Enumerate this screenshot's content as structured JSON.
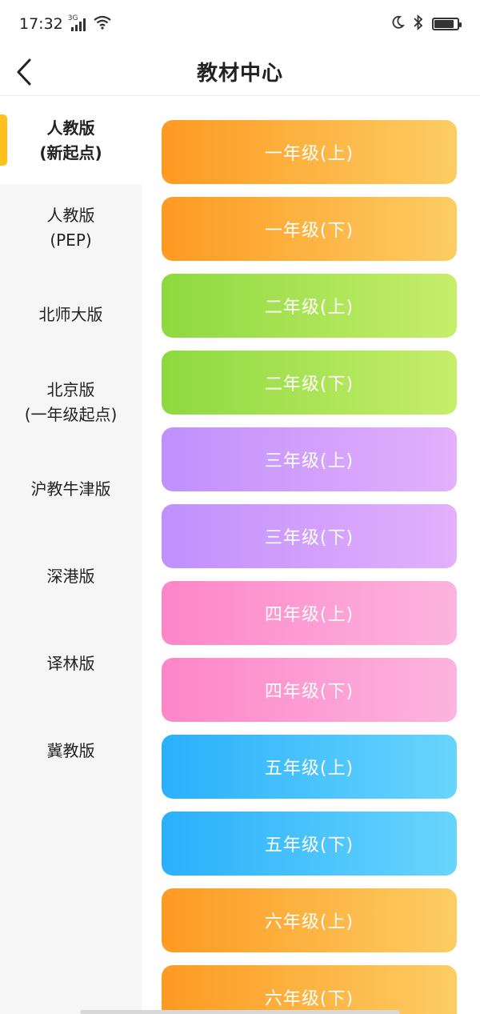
{
  "status": {
    "time": "17:32",
    "network": "3G",
    "icons": [
      "signal-icon",
      "wifi-icon",
      "moon-icon",
      "bluetooth-icon",
      "battery-icon"
    ],
    "battery_level": 0.85
  },
  "nav": {
    "title": "教材中心",
    "back_icon": "chevron-left-icon"
  },
  "sidebar": {
    "accent_color": "#ffc01e",
    "items": [
      {
        "label": "人教版\n(新起点)",
        "active": true
      },
      {
        "label": "人教版\n(PEP)",
        "active": false
      },
      {
        "label": "北师大版",
        "active": false
      },
      {
        "label": "北京版\n(一年级起点)",
        "active": false
      },
      {
        "label": "沪教牛津版",
        "active": false
      },
      {
        "label": "深港版",
        "active": false
      },
      {
        "label": "译林版",
        "active": false
      },
      {
        "label": "冀教版",
        "active": false
      }
    ]
  },
  "grades": [
    {
      "label": "一年级(上)",
      "color": "orange"
    },
    {
      "label": "一年级(下)",
      "color": "orange"
    },
    {
      "label": "二年级(上)",
      "color": "green"
    },
    {
      "label": "二年级(下)",
      "color": "green"
    },
    {
      "label": "三年级(上)",
      "color": "purple"
    },
    {
      "label": "三年级(下)",
      "color": "purple"
    },
    {
      "label": "四年级(上)",
      "color": "pink"
    },
    {
      "label": "四年级(下)",
      "color": "pink"
    },
    {
      "label": "五年级(上)",
      "color": "blue"
    },
    {
      "label": "五年级(下)",
      "color": "blue"
    },
    {
      "label": "六年级(上)",
      "color": "orange"
    },
    {
      "label": "六年级(下)",
      "color": "orange"
    }
  ]
}
